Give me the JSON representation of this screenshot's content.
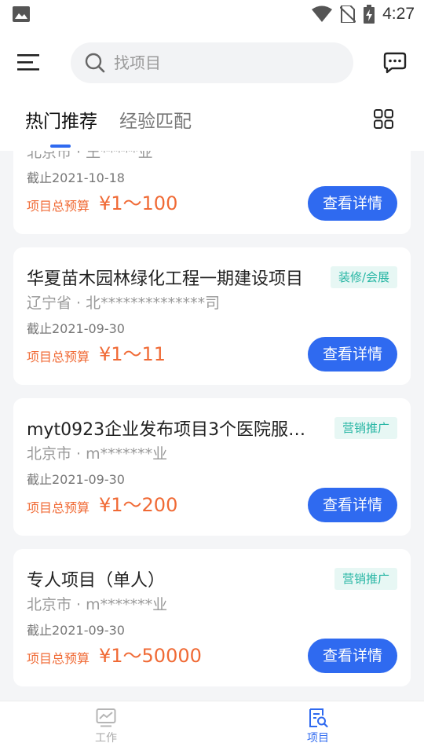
{
  "status_bar": {
    "time": "4:27"
  },
  "search": {
    "placeholder": "找项目"
  },
  "tabs": [
    {
      "label": "热门推荐",
      "active": true
    },
    {
      "label": "经验匹配",
      "active": false
    }
  ],
  "cards": [
    {
      "title": "",
      "tag": "",
      "location": "北京市 · 王*****业",
      "deadline": "截止2021-10-18",
      "budget_label": "项目总预算",
      "budget": "¥1～100",
      "button": "查看详情"
    },
    {
      "title": "华夏苗木园林绿化工程一期建设项目",
      "tag": "装修/会展",
      "location": "辽宁省 · 北**************司",
      "deadline": "截止2021-09-30",
      "budget_label": "项目总预算",
      "budget": "¥1～11",
      "button": "查看详情"
    },
    {
      "title": "myt0923企业发布项目3个医院服务...",
      "tag": "营销推广",
      "location": "北京市 · m*******业",
      "deadline": "截止2021-09-30",
      "budget_label": "项目总预算",
      "budget": "¥1～200",
      "button": "查看详情"
    },
    {
      "title": "专人项目（单人）",
      "tag": "营销推广",
      "location": "北京市 · m*******业",
      "deadline": "截止2021-09-30",
      "budget_label": "项目总预算",
      "budget": "¥1～50000",
      "button": "查看详情"
    }
  ],
  "bottom_nav": [
    {
      "label": "工作",
      "icon": "chart-board-icon",
      "active": false
    },
    {
      "label": "项目",
      "icon": "project-search-icon",
      "active": true
    }
  ],
  "colors": {
    "accent": "#2f6af0",
    "price": "#f06a35",
    "tag": "#27b6a4"
  }
}
